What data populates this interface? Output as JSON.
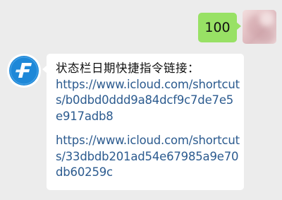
{
  "colors": {
    "chat_background": "#ececec",
    "sent_bubble": "#98e165",
    "received_bubble": "#ffffff",
    "link": "#2c5b8f",
    "contact_avatar_blue": "#1e88d8"
  },
  "sent_message": {
    "text": "100"
  },
  "received_message": {
    "title": "状态栏日期快捷指令链接：",
    "links": [
      {
        "lines": [
          "https://www.icloud.com/shortcut",
          "s/b0dbd0ddd9a84dcf9c7de7e5",
          "e917adb8"
        ]
      },
      {
        "lines": [
          "https://www.icloud.com/shortcut",
          "s/33dbdb201ad54e67985a9e70",
          "db60259c"
        ]
      }
    ]
  },
  "icons": {
    "contact_avatar": "f-logo-icon",
    "my_avatar": "blurred-photo-avatar"
  }
}
